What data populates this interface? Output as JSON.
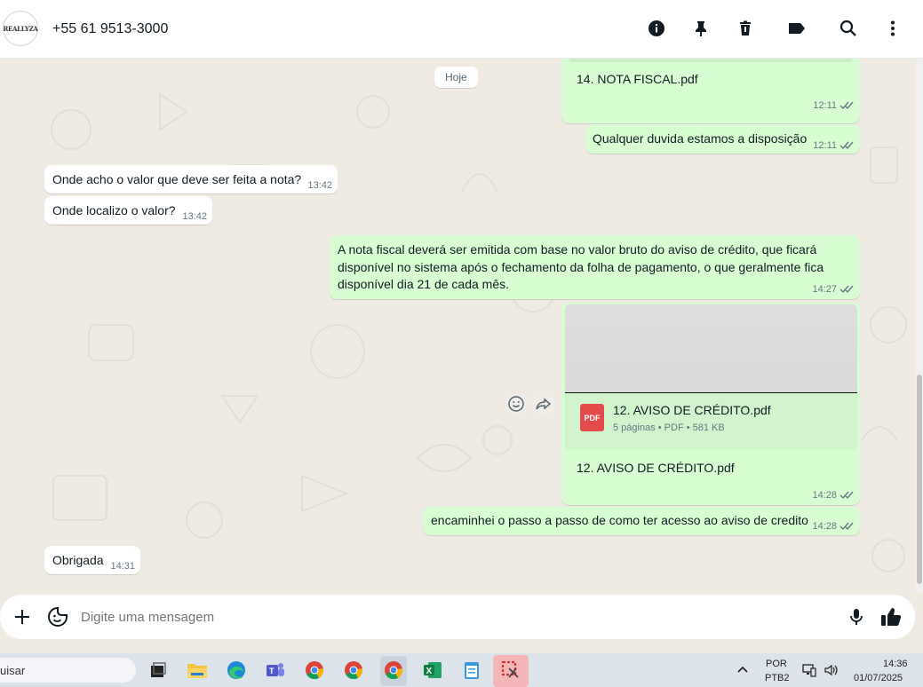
{
  "header": {
    "avatar_text": "REALLYZA",
    "contact": "+55 61 9513-3000",
    "icons": [
      "info-icon",
      "pin-icon",
      "delete-icon",
      "label-icon",
      "search-icon",
      "more-icon"
    ]
  },
  "chat": {
    "date_label": "Hoje",
    "messages": [
      {
        "dir": "out",
        "text": "14.  NOTA FISCAL.pdf",
        "time": "12:11"
      },
      {
        "dir": "out",
        "text": "Qualquer duvida estamos a disposição",
        "time": "12:11"
      },
      {
        "dir": "in",
        "text": "Onde acho o valor que deve ser feita a nota?",
        "time": "13:42"
      },
      {
        "dir": "in",
        "text": "Onde localizo o valor?",
        "time": "13:42"
      },
      {
        "dir": "out",
        "text_lines": [
          "A nota fiscal deverá ser emitida com base no valor bruto do aviso de crédito, que ficará",
          "disponível no sistema após o fechamento da folha de pagamento, o que geralmente fica",
          "disponível dia 21 de cada mês."
        ],
        "time": "14:27"
      },
      {
        "dir": "out",
        "doc_name": "12. AVISO DE CRÉDITO.pdf",
        "doc_meta": "5 páginas • PDF • 581 KB",
        "doc_badge": "PDF",
        "caption": "12.  AVISO DE CRÉDITO.pdf",
        "time": "14:28"
      },
      {
        "dir": "out",
        "text": "encaminhei o passo a passo de como ter acesso ao aviso de credito",
        "time": "14:28"
      },
      {
        "dir": "in",
        "text": "Obrigada",
        "time": "14:31"
      }
    ]
  },
  "composer": {
    "placeholder": "Digite uma mensagem",
    "icons": [
      "plus-icon",
      "sticker-icon",
      "mic-icon",
      "thumbs-up-icon"
    ]
  },
  "taskbar": {
    "search_text": "uisar",
    "lang_top": "POR",
    "lang_bottom": "PTB2",
    "clock_time": "14:36",
    "clock_date": "01/07/2025",
    "colors": {
      "accent": "#25d366",
      "outgoing": "#d9fdd3",
      "tick": "#667781",
      "pdf": "#e54a4a"
    }
  }
}
